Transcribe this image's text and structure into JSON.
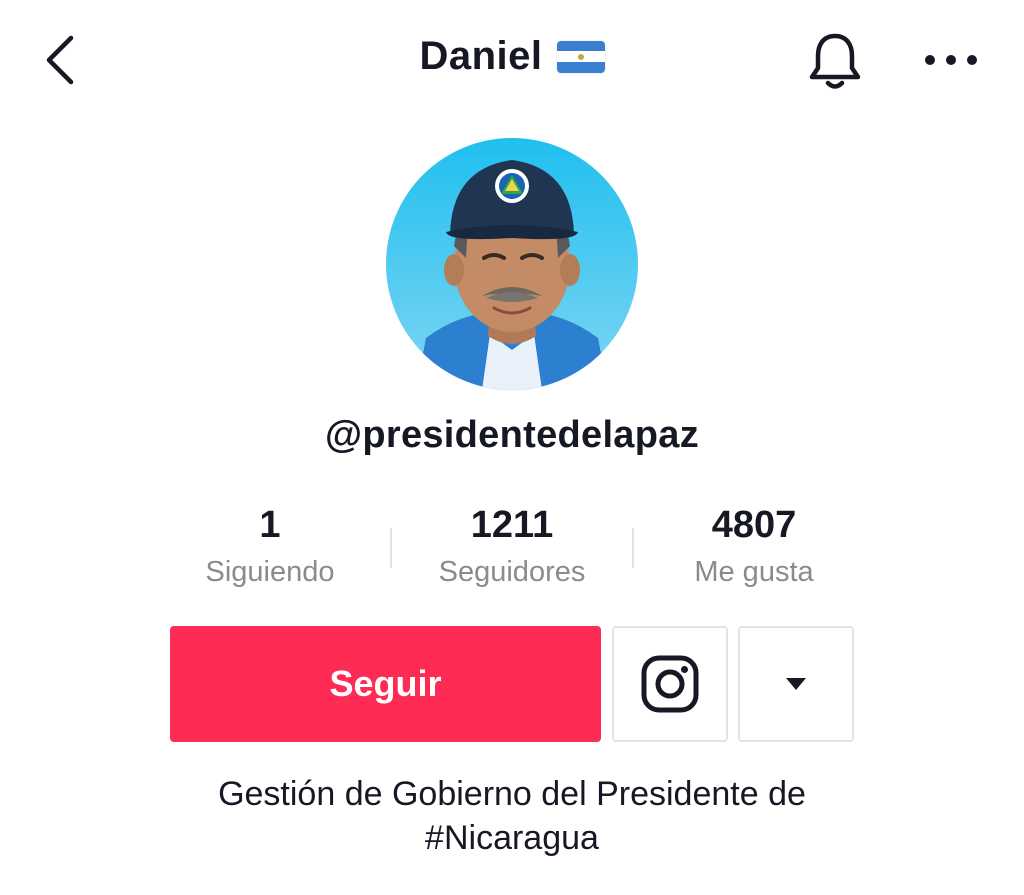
{
  "header": {
    "title": "Daniel",
    "flag_icon": "nicaragua-flag-icon",
    "back_icon": "chevron-left-icon",
    "bell_icon": "bell-icon",
    "more_icon": "ellipsis-icon"
  },
  "profile": {
    "username": "@presidentedelapaz",
    "avatar_icon": "avatar-photo"
  },
  "stats": [
    {
      "value": "1",
      "label": "Siguiendo"
    },
    {
      "value": "1211",
      "label": "Seguidores"
    },
    {
      "value": "4807",
      "label": "Me gusta"
    }
  ],
  "actions": {
    "follow_label": "Seguir",
    "instagram_icon": "instagram-icon",
    "dropdown_icon": "caret-down-icon"
  },
  "bio": {
    "line1": "Gestión de Gobierno del Presidente de",
    "line2": "#Nicaragua"
  },
  "colors": {
    "accent": "#fe2c55",
    "text_primary": "#161823",
    "text_secondary": "#8a8b91",
    "border": "#e3e3e6"
  }
}
